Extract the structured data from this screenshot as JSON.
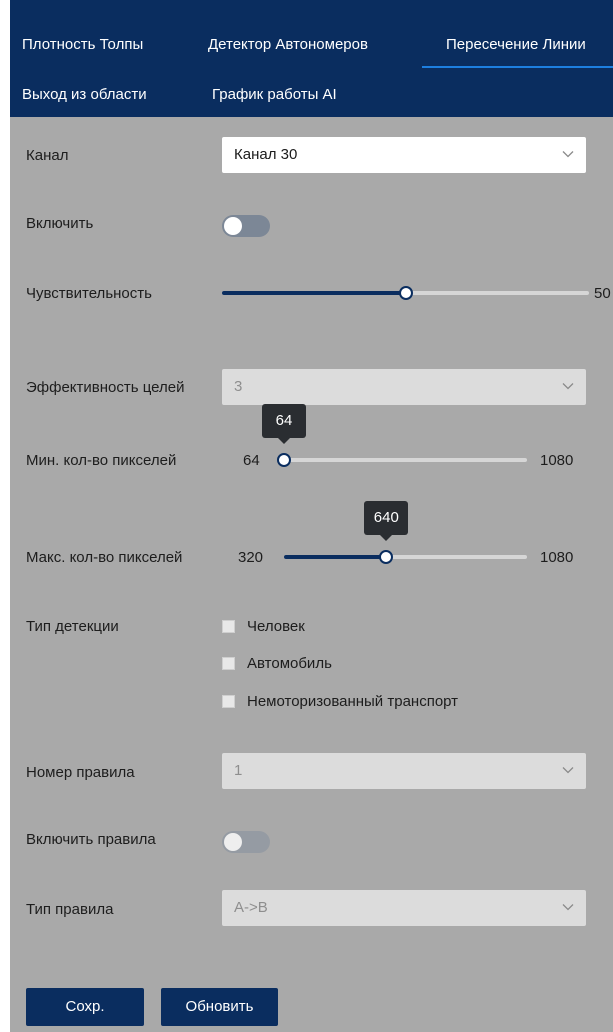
{
  "tabs": [
    {
      "label": "Плотность Толпы",
      "active": false
    },
    {
      "label": "Детектор Автономеров",
      "active": false
    },
    {
      "label": "Пересечение Линии",
      "active": true
    },
    {
      "label": "Выход из области",
      "active": false
    },
    {
      "label": "График работы AI",
      "active": false
    }
  ],
  "form": {
    "channel": {
      "label": "Канал",
      "value": "Канал 30"
    },
    "enable": {
      "label": "Включить",
      "on": false
    },
    "sensitivity": {
      "label": "Чувствительность",
      "value": 50,
      "max": 100,
      "value_text": "50"
    },
    "target_efficiency": {
      "label": "Эффективность целей",
      "value": "3"
    },
    "min_pixels": {
      "label": "Мин. кол-во пикселей",
      "min": 64,
      "max": 1080,
      "value": 64,
      "min_text": "64",
      "max_text": "1080",
      "tooltip": "64"
    },
    "max_pixels": {
      "label": "Макс. кол-во пикселей",
      "min": 320,
      "max": 1080,
      "value": 640,
      "min_text": "320",
      "max_text": "1080",
      "tooltip": "640"
    },
    "detection_type": {
      "label": "Тип детекции",
      "options": [
        {
          "label": "Человек",
          "checked": false
        },
        {
          "label": "Автомобиль",
          "checked": false
        },
        {
          "label": "Немоторизованный транспорт",
          "checked": false
        }
      ]
    },
    "rule_number": {
      "label": "Номер правила",
      "value": "1"
    },
    "enable_rules": {
      "label": "Включить правила",
      "on": false
    },
    "rule_type": {
      "label": "Тип правила",
      "value": "A->B"
    }
  },
  "buttons": {
    "save": "Сохр.",
    "refresh": "Обновить"
  },
  "colors": {
    "header_bg": "#0a2d5f",
    "panel_bg": "#a9a9a9",
    "accent": "#1d7fe0",
    "tooltip_bg": "#2a2d31"
  },
  "icons": {
    "dropdown": "chevron-down-icon"
  }
}
